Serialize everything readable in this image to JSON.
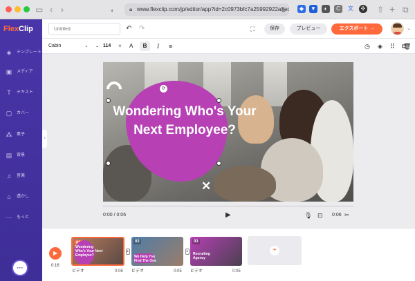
{
  "browser": {
    "url": "www.flexclip.com/jp/editor/app?id=2c0973bfc7a25992922a3ec58"
  },
  "brand": {
    "logo_text_a": "Flex",
    "logo_text_b": "Clip",
    "accent": "#ff6a3d",
    "sidebar_color": "#4a35a8"
  },
  "sidebar": {
    "items": [
      {
        "label": "テンプレート",
        "icon": "layers-icon"
      },
      {
        "label": "メディア",
        "icon": "media-icon"
      },
      {
        "label": "テキスト",
        "icon": "text-icon"
      },
      {
        "label": "カバー",
        "icon": "cover-icon"
      },
      {
        "label": "素子",
        "icon": "elements-icon"
      },
      {
        "label": "背景",
        "icon": "background-icon"
      },
      {
        "label": "音楽",
        "icon": "music-icon"
      },
      {
        "label": "透かし",
        "icon": "watermark-icon"
      },
      {
        "label": "もっと",
        "icon": "more-icon"
      }
    ]
  },
  "topbar": {
    "title_placeholder": "Untitled",
    "save_label": "保存",
    "preview_label": "プレビュー",
    "export_label": "エクスポート →"
  },
  "textbar": {
    "font": "Cabin",
    "font_size": "114"
  },
  "canvas": {
    "title_text": "Wondering Who's Your Next Employee?",
    "time_current": "0:00 / 0:06",
    "duration": "0:06"
  },
  "timeline": {
    "total_time": "0:16",
    "clips": [
      {
        "num": "01",
        "text": "Wondering Who's Your Next Employee?",
        "label": "ビデオ",
        "duration": "0:06"
      },
      {
        "num": "02",
        "text": "We Help You Find The One",
        "label": "ビデオ",
        "duration": "0:05"
      },
      {
        "num": "03",
        "text": "Recruiting Agency",
        "label": "ビデオ",
        "duration": "0:05"
      }
    ],
    "add_label": "+"
  }
}
